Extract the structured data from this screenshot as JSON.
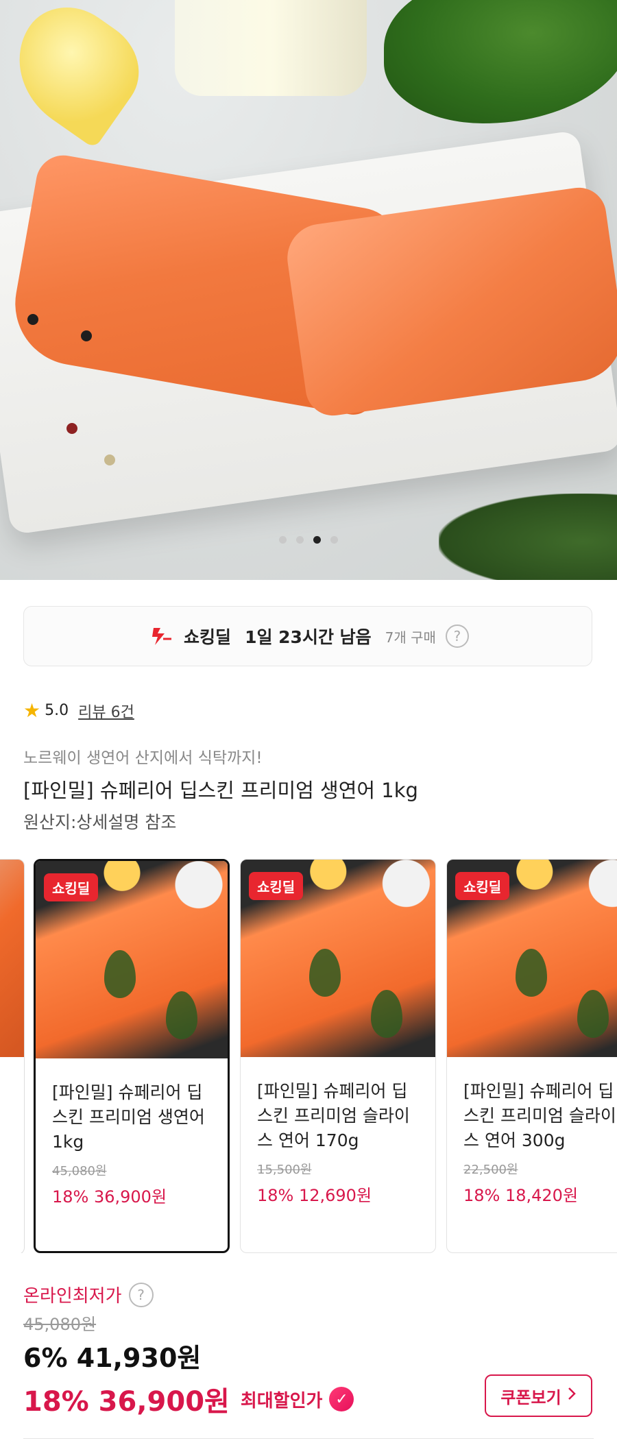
{
  "carousel": {
    "dots": 4,
    "active_index": 2
  },
  "deal": {
    "title": "쇼킹딜",
    "timer": "1일 23시간 남음",
    "purchases": "7개 구매",
    "help": "?",
    "accent_color": "#e8262f"
  },
  "rating": {
    "score": "5.0",
    "reviews": "리뷰 6건"
  },
  "product": {
    "subtitle": "노르웨이 생연어 산지에서 식탁까지!",
    "title": "[파인밀] 슈페리어 딥스킨 프리미엄 생연어 1kg",
    "origin": "원산지:상세설명 참조"
  },
  "variants": [
    {
      "badge": "쇼킹딜",
      "name": "[파인밀] 슈페리어 딥스킨 프리미엄 생연어 1kg",
      "original_price": "45,080원",
      "sale": "18% 36,900원",
      "selected": true
    },
    {
      "badge": "쇼킹딜",
      "name": "[파인밀] 슈페리어 딥스킨 프리미엄 슬라이스 연어 170g",
      "original_price": "15,500원",
      "sale": "18% 12,690원",
      "selected": false
    },
    {
      "badge": "쇼킹딜",
      "name": "[파인밀] 슈페리어 딥스킨 프리미엄 슬라이스 연어 300g",
      "original_price": "22,500원",
      "sale": "18% 18,420원",
      "selected": false
    }
  ],
  "pricing": {
    "lowest_label": "온라인최저가",
    "help": "?",
    "original": "45,080원",
    "discount": "6% 41,930원",
    "max_discount_price": "18% 36,900원",
    "max_discount_label": "최대할인가",
    "coupon_button": "쿠폰보기",
    "accent_color": "#d8174b"
  },
  "icons": [
    "lightning-bolt-icon",
    "help-circle-icon",
    "star-icon",
    "check-badge-icon",
    "chevron-right-icon"
  ]
}
